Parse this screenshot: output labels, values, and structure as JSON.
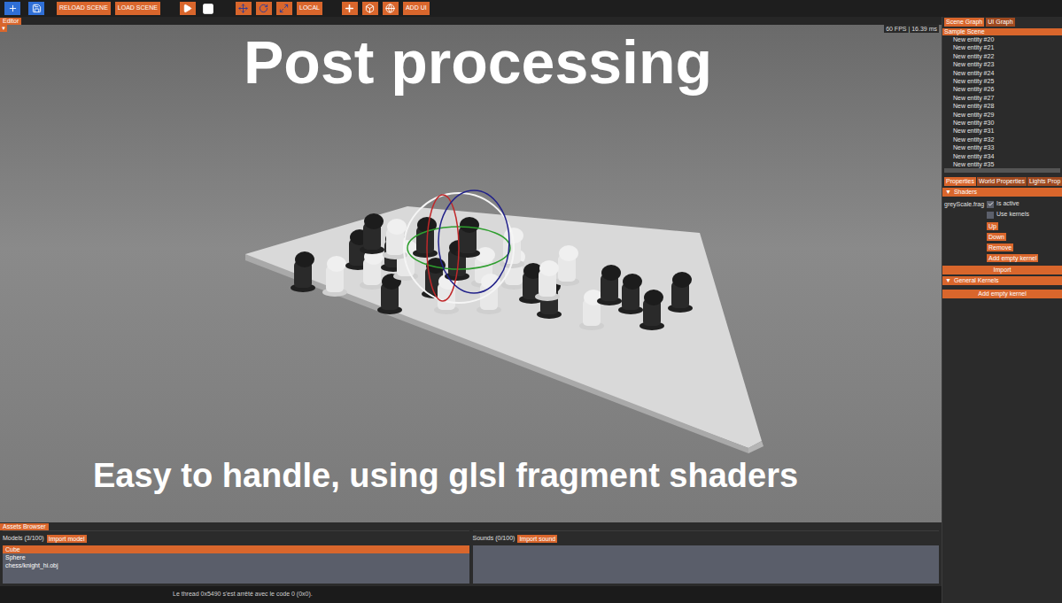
{
  "toolbar": {
    "scene_buttons": [
      "RELOAD SCENE",
      "LOAD SCENE"
    ],
    "space_button": "LOCAL",
    "ui_button": "ADD UI"
  },
  "viewport": {
    "tab": "Editor",
    "collapse": "▼",
    "fps": "60 FPS | 16.39 ms",
    "title": "Post processing",
    "subtitle": "Easy to handle, using glsl fragment shaders"
  },
  "scene_panel": {
    "tabs": [
      {
        "label": "Scene Graph",
        "selected": true
      },
      {
        "label": "UI Graph",
        "selected": false
      }
    ],
    "scene": "Sample Scene",
    "entities": [
      "New entity #20",
      "New entity #21",
      "New entity #22",
      "New entity #23",
      "New entity #24",
      "New entity #25",
      "New entity #26",
      "New entity #27",
      "New entity #28",
      "New entity #29",
      "New entity #30",
      "New entity #31",
      "New entity #32",
      "New entity #33",
      "New entity #34",
      "New entity #35"
    ]
  },
  "properties": {
    "tabs": [
      {
        "label": "Properties",
        "selected": true
      },
      {
        "label": "World Properties",
        "selected": false
      },
      {
        "label": "Lights Prop",
        "selected": false
      }
    ],
    "shaders": {
      "arrow": "▼",
      "header": "Shaders",
      "expanded": true,
      "items": [
        {
          "name": "greyScale.frag",
          "options": [
            {
              "label": "Is active",
              "checked": true
            },
            {
              "label": "Use kernels",
              "checked": false
            }
          ],
          "buttons": [
            "Up",
            "Down",
            "Remove",
            "Add empty kernel"
          ]
        }
      ],
      "import": "Import"
    },
    "general_kernels": {
      "arrow": "▼",
      "header": "General Kernels",
      "expanded": true,
      "button": "Add empty kernel"
    }
  },
  "assets": {
    "tab": "Assets Browser",
    "models": {
      "title": "Models (3/100)",
      "button": "Import model",
      "items": [
        {
          "label": "Cube",
          "selected": true
        },
        {
          "label": "Sphere",
          "selected": false
        },
        {
          "label": "chess/knight_hi.obj",
          "selected": false
        }
      ]
    },
    "sounds": {
      "title": "Sounds (0/100)",
      "button": "Import sound",
      "items": []
    }
  },
  "console": {
    "text": "Le thread 0x5490 s'est arrêté avec le code 0 (0x0)."
  }
}
